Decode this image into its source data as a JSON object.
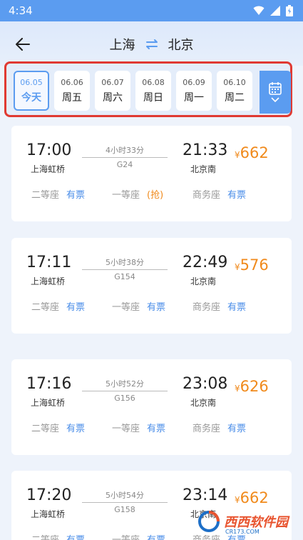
{
  "status_bar": {
    "time": "4:34"
  },
  "header": {
    "from": "上海",
    "to": "北京"
  },
  "dates": [
    {
      "date": "06.05",
      "weekday": "今天",
      "active": true
    },
    {
      "date": "06.06",
      "weekday": "周五",
      "active": false
    },
    {
      "date": "06.07",
      "weekday": "周六",
      "active": false
    },
    {
      "date": "06.08",
      "weekday": "周日",
      "active": false
    },
    {
      "date": "06.09",
      "weekday": "周一",
      "active": false
    },
    {
      "date": "06.10",
      "weekday": "周二",
      "active": false
    }
  ],
  "seat_names": [
    "二等座",
    "一等座",
    "商务座"
  ],
  "trains": [
    {
      "dep_time": "17:00",
      "dep_station": "上海虹桥",
      "duration": "4小时33分",
      "code": "G24",
      "arr_time": "21:33",
      "arr_station": "北京南",
      "currency": "¥",
      "price": "662",
      "availability": [
        "有票",
        "(抢)",
        "有票"
      ]
    },
    {
      "dep_time": "17:11",
      "dep_station": "上海虹桥",
      "duration": "5小时38分",
      "code": "G154",
      "arr_time": "22:49",
      "arr_station": "北京南",
      "currency": "¥",
      "price": "576",
      "availability": [
        "有票",
        "有票",
        "有票"
      ]
    },
    {
      "dep_time": "17:16",
      "dep_station": "上海虹桥",
      "duration": "5小时52分",
      "code": "G156",
      "arr_time": "23:08",
      "arr_station": "北京南",
      "currency": "¥",
      "price": "626",
      "availability": [
        "有票",
        "有票",
        "有票"
      ]
    },
    {
      "dep_time": "17:20",
      "dep_station": "上海虹桥",
      "duration": "5小时54分",
      "code": "G158",
      "arr_time": "23:14",
      "arr_station": "北京南",
      "currency": "¥",
      "price": "662",
      "availability": [
        "有票",
        "有票",
        "有票"
      ]
    }
  ],
  "watermark": {
    "name": "西西软件园",
    "site": "CR173.COM"
  },
  "colors": {
    "accent": "#5b9cf0",
    "price": "#f08a1c",
    "highlight_border": "#e03a32",
    "available": "#4a8de8"
  }
}
